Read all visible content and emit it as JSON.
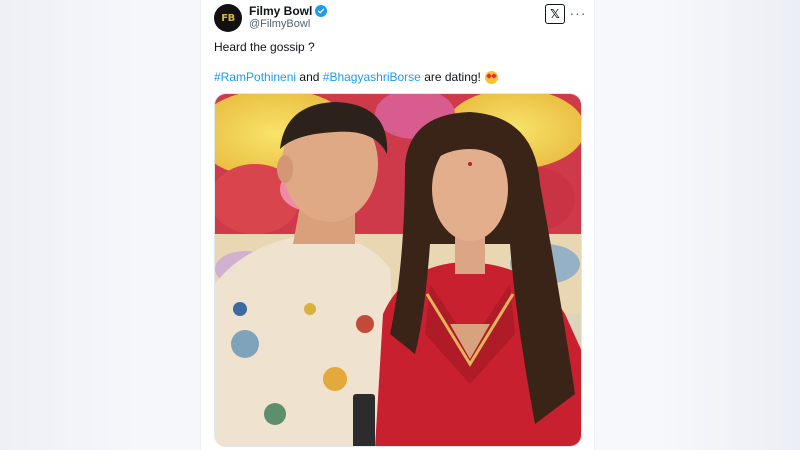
{
  "tweet": {
    "display_name": "Filmy Bowl",
    "handle": "@FilmyBowl",
    "avatar_text": "FB",
    "text_line1": "Heard the gossip ?",
    "hashtag1": "#RamPothineni",
    "connector": "and",
    "hashtag2": "#BhagyashriBorse",
    "text_end": "are dating!",
    "emoji": "smiling-face-with-heart-eyes",
    "photo_alt": "Ram Pothineni and Bhagyashri Borse standing in front of a floral backdrop"
  },
  "icons": {
    "verified": "verified-badge-icon",
    "platform": "x-logo-icon",
    "more": "more-options-icon"
  },
  "colors": {
    "link": "#1d9bf0",
    "text": "#0f1419",
    "muted": "#536471",
    "avatar_bg": "#111111",
    "avatar_gold": "#d8b24c"
  }
}
